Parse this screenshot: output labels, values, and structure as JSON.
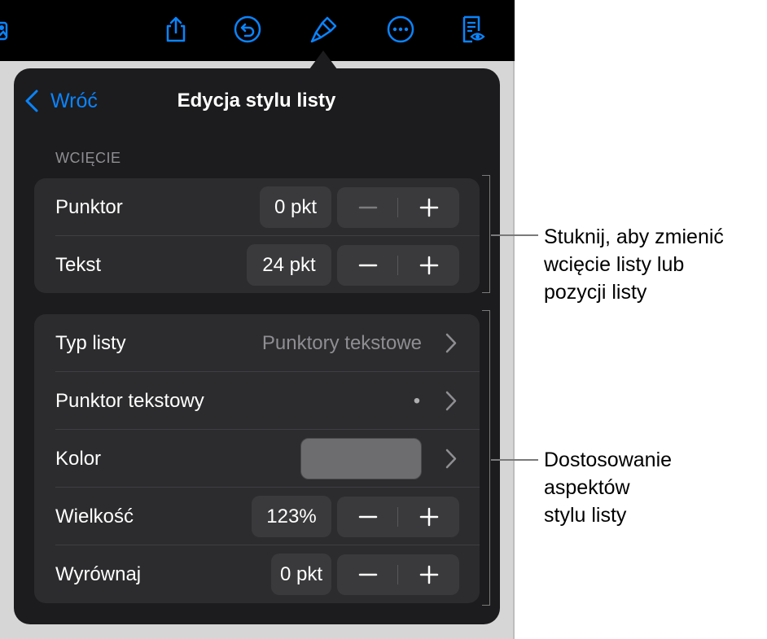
{
  "toolbar": {
    "icons": [
      "media-icon",
      "share-icon",
      "undo-icon",
      "format-brush-icon",
      "more-icon",
      "reading-view-icon"
    ]
  },
  "popover": {
    "back_label": "Wróć",
    "title": "Edycja stylu listy",
    "section_label": "WCIĘCIE",
    "indent_rows": [
      {
        "label": "Punktor",
        "value": "0 pkt"
      },
      {
        "label": "Tekst",
        "value": "24 pkt"
      }
    ],
    "style_rows": {
      "list_type": {
        "label": "Typ listy",
        "value": "Punktory tekstowe"
      },
      "text_bullet": {
        "label": "Punktor tekstowy",
        "value": "•"
      },
      "color": {
        "label": "Kolor",
        "swatch_color": "#6d6d6f"
      },
      "size": {
        "label": "Wielkość",
        "value": "123%"
      },
      "align": {
        "label": "Wyrównaj",
        "value": "0 pkt"
      }
    }
  },
  "callouts": {
    "indent": [
      "Stuknij, aby zmienić",
      "wcięcie listy lub",
      "pozycji listy"
    ],
    "style": [
      "Dostosowanie",
      "aspektów",
      "stylu listy"
    ]
  },
  "colors": {
    "accent": "#0a84ff",
    "popover_bg": "#1c1c1e",
    "group_bg": "#2c2c2e",
    "control_bg": "#3a3a3c"
  }
}
